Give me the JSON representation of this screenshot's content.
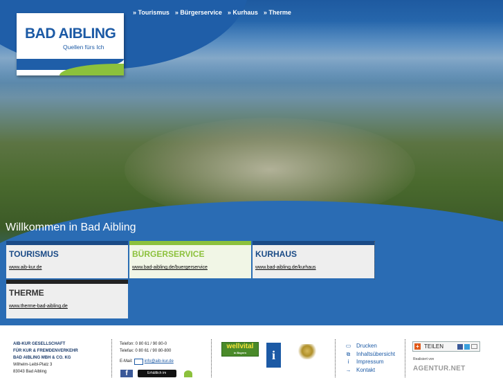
{
  "top_nav": [
    "» Tourismus",
    "» Bürgerservice",
    "» Kurhaus",
    "» Therme"
  ],
  "logo": {
    "name": "BAD AIBLING",
    "slogan": "Quellen fürs Ich"
  },
  "welcome": "Willkommen in Bad Aibling",
  "boxes": [
    {
      "title": "TOURISMUS",
      "link": "www.aib-kur.de"
    },
    {
      "title": "BÜRGERSERVICE",
      "link": "www.bad-aibling.de/buergerservice"
    },
    {
      "title": "KURHAUS",
      "link": "www.bad-aibling.de/kurhaus"
    },
    {
      "title": "THERME",
      "link": "www.therme-bad-aibling.de"
    }
  ],
  "footer": {
    "company": [
      "AIB-KUR GESELLSCHAFT",
      "FÜR KUR & FREMDENVERKEHR",
      "BAD AIBLING MBH & CO. KG"
    ],
    "address": [
      "Wilhelm-Leibl-Platz 3",
      "83043 Bad Aibling"
    ],
    "phone": "Telefon: 0 80 61 / 90 80-0",
    "fax": "Telefax: 0 80 61 / 90 80-800",
    "email_label": "E-Mail:",
    "email": "info@aib-kur.de",
    "app_badge": "Erhältlich im",
    "wellvital": "wellvital",
    "wellvital_sub": "in Bayern",
    "links": [
      "Drucken",
      "Inhaltsübersicht",
      "Impressum",
      "Kontakt"
    ],
    "share": "TEILEN",
    "realized_by": "Realisiert von",
    "agency": "AGENTUR.NET"
  }
}
